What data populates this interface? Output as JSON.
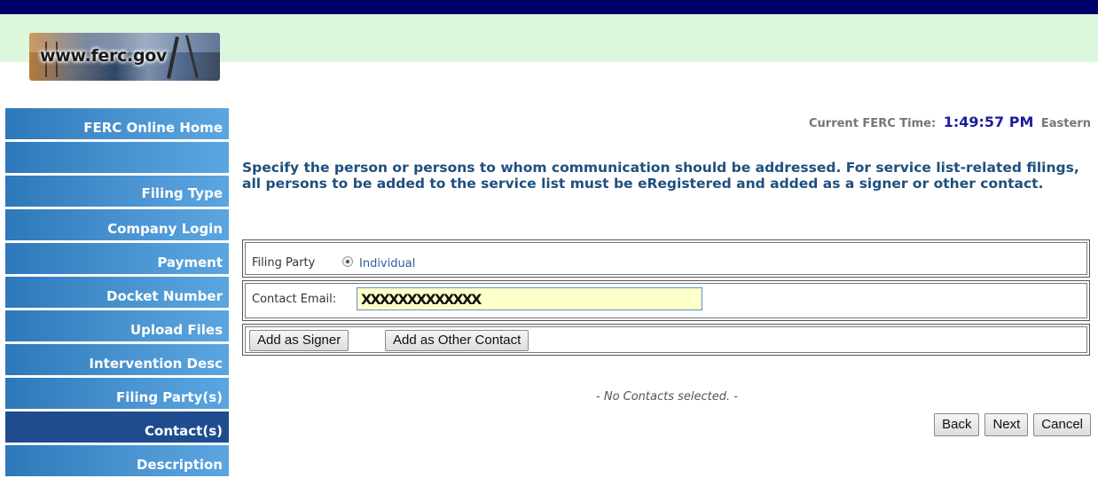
{
  "logo": {
    "text": "www.ferc.gov"
  },
  "sidebar": {
    "items": [
      {
        "label": "FERC Online Home"
      },
      {
        "label": ""
      },
      {
        "label": "Filing Type"
      },
      {
        "label": "Company Login"
      },
      {
        "label": "Payment"
      },
      {
        "label": "Docket Number"
      },
      {
        "label": "Upload Files"
      },
      {
        "label": "Intervention Desc"
      },
      {
        "label": "Filing Party(s)"
      },
      {
        "label": "Contact(s)"
      },
      {
        "label": "Description"
      }
    ],
    "active_item": "Contact(s)"
  },
  "header": {
    "time_label": "Current FERC Time:",
    "time_value": "1:49:57 PM",
    "time_zone": "Eastern"
  },
  "main": {
    "instructions": "Specify the person or persons to whom communication should be addressed. For service list-related filings, all persons to be added to the service list must be eRegistered and added as a signer or other contact.",
    "filing_party_label": "Filing Party",
    "filing_party_option": "Individual",
    "contact_email_label": "Contact Email:",
    "contact_email_value": "XXXXXXXXXXXXX",
    "add_signer_label": "Add as Signer",
    "add_other_label": "Add as Other Contact",
    "no_contacts_text": "- No Contacts selected. -"
  },
  "footer": {
    "back_label": "Back",
    "next_label": "Next",
    "cancel_label": "Cancel"
  },
  "colors": {
    "top_bar": "#00006b",
    "green_band": "#dcf7dc",
    "nav_blue": "#4a93d1",
    "nav_active": "#1e4c8e",
    "instruction_text": "#1f4f7f",
    "email_bg": "#ffffc8"
  }
}
